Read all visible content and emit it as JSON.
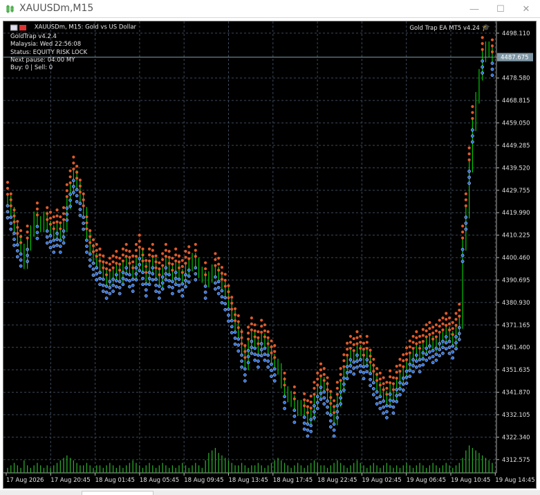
{
  "window": {
    "title": "XAUUSDm,M15",
    "icon": "candlestick-chart-icon",
    "controls": [
      "minimize-icon",
      "maximize-icon",
      "close-icon"
    ]
  },
  "chart": {
    "symbol_line": "XAUUSDm, M15:  Gold vs US Dollar",
    "ea_label": "Gold Trap EA MT5 v4.24",
    "info_lines": [
      "GoldTrap v4.2.4",
      "Malaysia: Wed 22:56:08",
      "Status: EQUITY RISK LOCK",
      "Next pause: 04:00 MY",
      "Buy: 0 | Sell: 0"
    ],
    "current_price": "4487.675",
    "colors": {
      "background": "#000000",
      "grid": "#3c4a5a",
      "text": "#e0e0e0",
      "bull": "#00c800",
      "sell_marker": "#e05a2a",
      "buy_marker": "#2a6fe0",
      "price_tag": "#7f96a4"
    }
  },
  "chart_data": {
    "type": "line",
    "title": "XAUUSDm, M15:  Gold vs US Dollar",
    "y_ticks": [
      "4498.110",
      "4487.675",
      "4478.580",
      "4468.815",
      "4459.050",
      "4449.285",
      "4439.520",
      "4429.755",
      "4419.990",
      "4410.225",
      "4400.460",
      "4390.695",
      "4380.930",
      "4371.165",
      "4361.400",
      "4351.635",
      "4341.870",
      "4332.105",
      "4322.340",
      "4312.575"
    ],
    "x_ticks": [
      "17 Aug 2026",
      "17 Aug 20:45",
      "18 Aug 01:45",
      "18 Aug 05:45",
      "18 Aug 09:45",
      "18 Aug 13:45",
      "18 Aug 17:45",
      "18 Aug 22:45",
      "19 Aug 02:45",
      "19 Aug 06:45",
      "19 Aug 10:45",
      "19 Aug 14:45"
    ],
    "ylim": [
      4308,
      4502
    ],
    "series": [
      {
        "values": [
          4425,
          4420,
          4413,
          4408,
          4404,
          4398,
          4406,
          4412,
          4418,
          4416,
          4414,
          4418,
          4414,
          4412,
          4410,
          4413,
          4410,
          4414,
          4424,
          4430,
          4436,
          4432,
          4426,
          4420,
          4410,
          4404,
          4400,
          4398,
          4396,
          4393,
          4390,
          4392,
          4393,
          4395,
          4392,
          4396,
          4398,
          4395,
          4393,
          4398,
          4402,
          4396,
          4391,
          4396,
          4398,
          4393,
          4390,
          4394,
          4398,
          4395,
          4392,
          4396,
          4393,
          4391,
          4395,
          4397,
          4400,
          4398,
          4394,
          4392,
          4390,
          4392,
          4395,
          4394,
          4392,
          4388,
          4385,
          4380,
          4375,
          4370,
          4367,
          4360,
          4354,
          4362,
          4366,
          4363,
          4360,
          4365,
          4363,
          4360,
          4356,
          4354,
          4352,
          4346,
          4342,
          4340,
          4338,
          4336,
          4334,
          4336,
          4333,
          4330,
          4332,
          4338,
          4342,
          4346,
          4344,
          4340,
          4334,
          4330,
          4338,
          4344,
          4350,
          4355,
          4358,
          4357,
          4360,
          4358,
          4355,
          4358,
          4352,
          4348,
          4344,
          4342,
          4340,
          4338,
          4343,
          4340,
          4345,
          4348,
          4350,
          4353,
          4356,
          4358,
          4360,
          4358,
          4361,
          4363,
          4364,
          4362,
          4363,
          4365,
          4366,
          4368,
          4366,
          4364,
          4368,
          4372,
          4406,
          4420,
          4440,
          4458,
          4470,
          4480,
          4488,
          4492,
          4490,
          4487
        ]
      }
    ],
    "volume_values": [
      2,
      3,
      4,
      3,
      2,
      5,
      3,
      2,
      3,
      4,
      3,
      2,
      3,
      2,
      3,
      4,
      5,
      6,
      7,
      6,
      5,
      4,
      3,
      3,
      4,
      3,
      2,
      3,
      3,
      2,
      3,
      4,
      3,
      2,
      3,
      2,
      3,
      4,
      5,
      4,
      3,
      2,
      3,
      4,
      3,
      2,
      3,
      4,
      3,
      2,
      3,
      2,
      3,
      4,
      3,
      2,
      3,
      4,
      3,
      2,
      5,
      8,
      9,
      10,
      8,
      7,
      6,
      5,
      4,
      3,
      3,
      4,
      3,
      2,
      3,
      3,
      4,
      3,
      2,
      3,
      4,
      5,
      6,
      5,
      4,
      3,
      2,
      3,
      4,
      3,
      2,
      3,
      4,
      5,
      4,
      3,
      3,
      2,
      3,
      4,
      5,
      4,
      3,
      2,
      3,
      4,
      5,
      4,
      3,
      2,
      3,
      4,
      3,
      2,
      3,
      4,
      3,
      2,
      3,
      2,
      3,
      4,
      3,
      2,
      3,
      4,
      3,
      2,
      3,
      4,
      3,
      2,
      3,
      4,
      3,
      2,
      3,
      4,
      6,
      9,
      11,
      10,
      9,
      8,
      7,
      6,
      5,
      4
    ]
  }
}
